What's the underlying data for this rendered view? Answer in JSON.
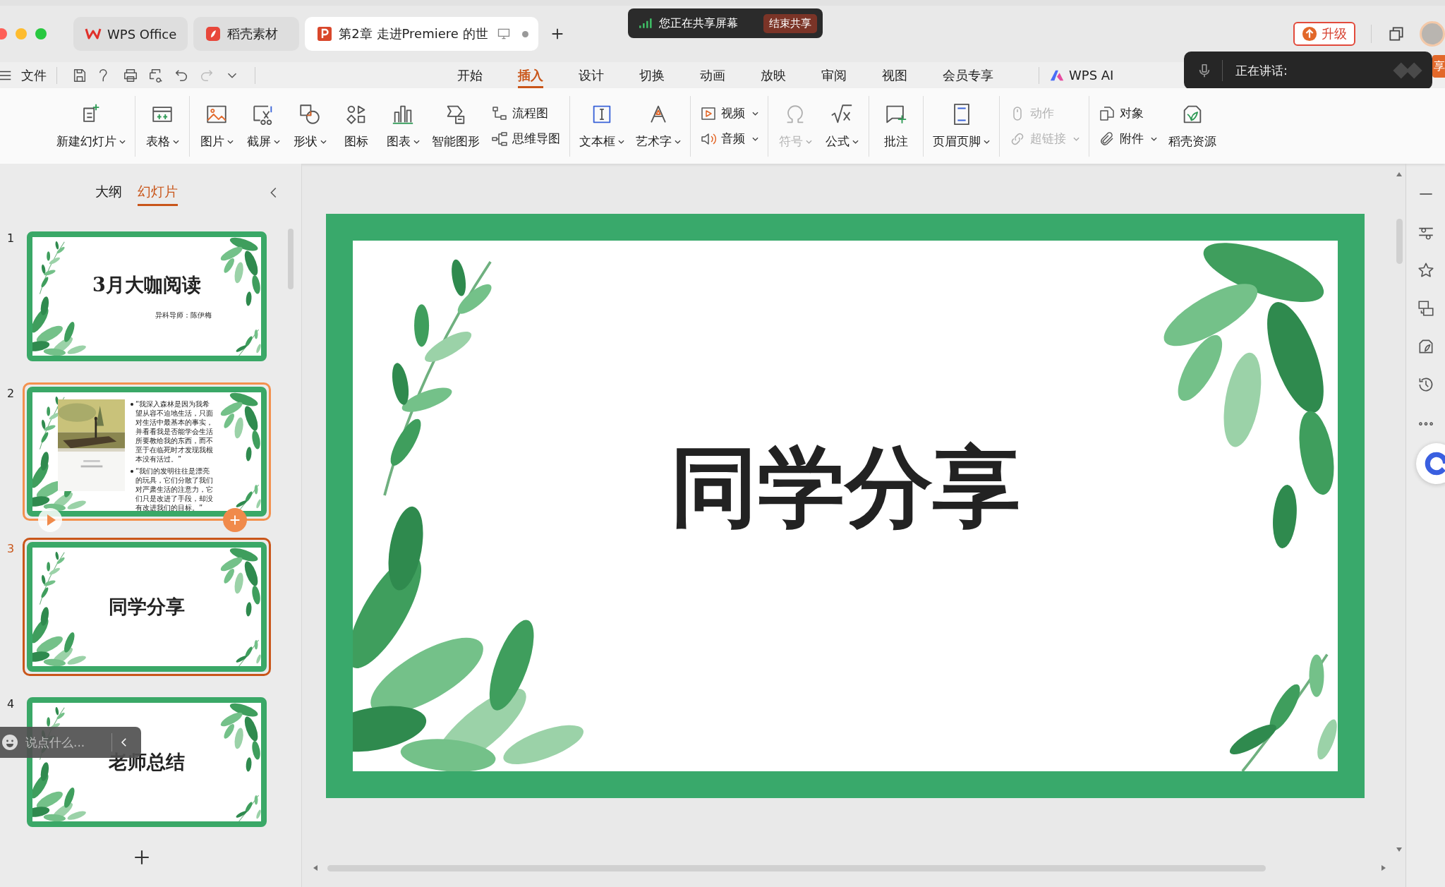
{
  "window_tabs": [
    {
      "label": "WPS Office",
      "kind": "wps",
      "selected": false
    },
    {
      "label": "稻壳素材",
      "kind": "docer",
      "selected": false
    },
    {
      "label": "第2章  走进Premiere 的世",
      "kind": "ppt",
      "selected": true
    }
  ],
  "share_banner": {
    "text": "您正在共享屏幕",
    "button": "结束共享"
  },
  "upgrade_button": "升级",
  "file_menu": "文件",
  "menu_tabs": [
    {
      "label": "开始",
      "selected": false
    },
    {
      "label": "插入",
      "selected": true
    },
    {
      "label": "设计",
      "selected": false
    },
    {
      "label": "切换",
      "selected": false
    },
    {
      "label": "动画",
      "selected": false
    },
    {
      "label": "放映",
      "selected": false
    },
    {
      "label": "审阅",
      "selected": false
    },
    {
      "label": "视图",
      "selected": false
    },
    {
      "label": "会员专享",
      "selected": false
    }
  ],
  "ai_button": "WPS AI",
  "speaking_panel": {
    "label": "正在讲话:"
  },
  "share_tab": "享",
  "ribbon": [
    {
      "items": [
        {
          "kind": "large",
          "label": "新建幻灯片",
          "dropdown": true,
          "disabled": false
        }
      ]
    },
    {
      "items": [
        {
          "kind": "large",
          "label": "表格",
          "dropdown": true,
          "disabled": false
        }
      ]
    },
    {
      "items": [
        {
          "kind": "large",
          "label": "图片",
          "dropdown": true,
          "disabled": false
        },
        {
          "kind": "large",
          "label": "截屏",
          "dropdown": true,
          "disabled": false
        },
        {
          "kind": "large",
          "label": "形状",
          "dropdown": true,
          "disabled": false
        },
        {
          "kind": "large",
          "label": "图标",
          "dropdown": false,
          "disabled": false
        },
        {
          "kind": "large",
          "label": "图表",
          "dropdown": true,
          "disabled": false
        },
        {
          "kind": "large",
          "label": "智能图形",
          "dropdown": false,
          "disabled": false
        },
        {
          "kind": "stack",
          "items": [
            {
              "label": "流程图",
              "dropdown": false,
              "disabled": false
            },
            {
              "label": "思维导图",
              "dropdown": false,
              "disabled": false
            }
          ]
        }
      ]
    },
    {
      "items": [
        {
          "kind": "large",
          "label": "文本框",
          "dropdown": true,
          "disabled": false
        },
        {
          "kind": "large",
          "label": "艺术字",
          "dropdown": true,
          "disabled": false
        }
      ]
    },
    {
      "items": [
        {
          "kind": "stack",
          "items": [
            {
              "label": "视频",
              "dropdown": true,
              "disabled": false
            },
            {
              "label": "音频",
              "dropdown": true,
              "disabled": false
            }
          ]
        }
      ]
    },
    {
      "items": [
        {
          "kind": "large",
          "label": "符号",
          "dropdown": true,
          "disabled": true
        },
        {
          "kind": "large",
          "label": "公式",
          "dropdown": true,
          "disabled": false
        }
      ]
    },
    {
      "items": [
        {
          "kind": "large",
          "label": "批注",
          "dropdown": false,
          "disabled": false
        }
      ]
    },
    {
      "items": [
        {
          "kind": "large",
          "label": "页眉页脚",
          "dropdown": true,
          "disabled": false
        }
      ]
    },
    {
      "items": [
        {
          "kind": "stack",
          "items": [
            {
              "label": "动作",
              "dropdown": false,
              "disabled": true
            },
            {
              "label": "超链接",
              "dropdown": true,
              "disabled": true
            }
          ]
        }
      ]
    },
    {
      "items": [
        {
          "kind": "stack",
          "items": [
            {
              "label": "对象",
              "dropdown": false,
              "disabled": false
            },
            {
              "label": "附件",
              "dropdown": true,
              "disabled": false
            }
          ]
        },
        {
          "kind": "large",
          "label": "稻壳资源",
          "dropdown": false,
          "disabled": false
        }
      ]
    }
  ],
  "panel_tabs": [
    {
      "label": "大纲",
      "selected": false
    },
    {
      "label": "幻灯片",
      "selected": true
    }
  ],
  "slides": [
    {
      "number": "1",
      "kind": "title",
      "title": "3月大咖阅读",
      "subtitle": "异科导师：陈伊梅",
      "selected": false,
      "hovered": false
    },
    {
      "number": "2",
      "kind": "quote",
      "bullets": [
        "“我深入森林是因为我希望从容不迫地生活，只面对生活中最基本的事实，并看看我是否能学会生活所要教给我的东西，而不至于在临死时才发现我根本没有活过。”",
        "“我们的发明往往是漂亮的玩具，它们分散了我们对严肃生活的注意力，它们只是改进了手段，却没有改进我们的目标。”"
      ],
      "selected": false,
      "hovered": true
    },
    {
      "number": "3",
      "kind": "title",
      "title": "同学分享",
      "selected": true,
      "hovered": false
    },
    {
      "number": "4",
      "kind": "title",
      "title": "老师总结",
      "selected": false,
      "hovered": false
    }
  ],
  "chat_box": {
    "placeholder": "说点什么..."
  },
  "editor": {
    "title": "同学分享"
  }
}
